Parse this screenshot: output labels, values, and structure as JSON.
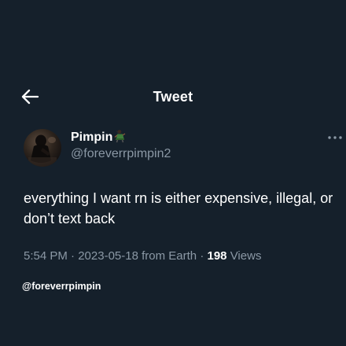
{
  "header": {
    "title": "Tweet",
    "back_icon": "arrow-left-icon"
  },
  "tweet": {
    "display_name": "Pimpin",
    "name_emoji_icon": "dancing-figure-emoji",
    "username": "@foreverrpimpin2",
    "text": "everything I want rn is either expensive, illegal, or don’t text back",
    "time": "5:54 PM",
    "date": "2023-05-18",
    "source": "from Earth",
    "separator": " · ",
    "views_count": "198",
    "views_label": "Views",
    "more_icon": "more-dots-icon"
  },
  "watermark": "@foreverrpimpin",
  "colors": {
    "background": "#15202b",
    "text_primary": "#ffffff",
    "text_secondary": "#8b98a5"
  }
}
